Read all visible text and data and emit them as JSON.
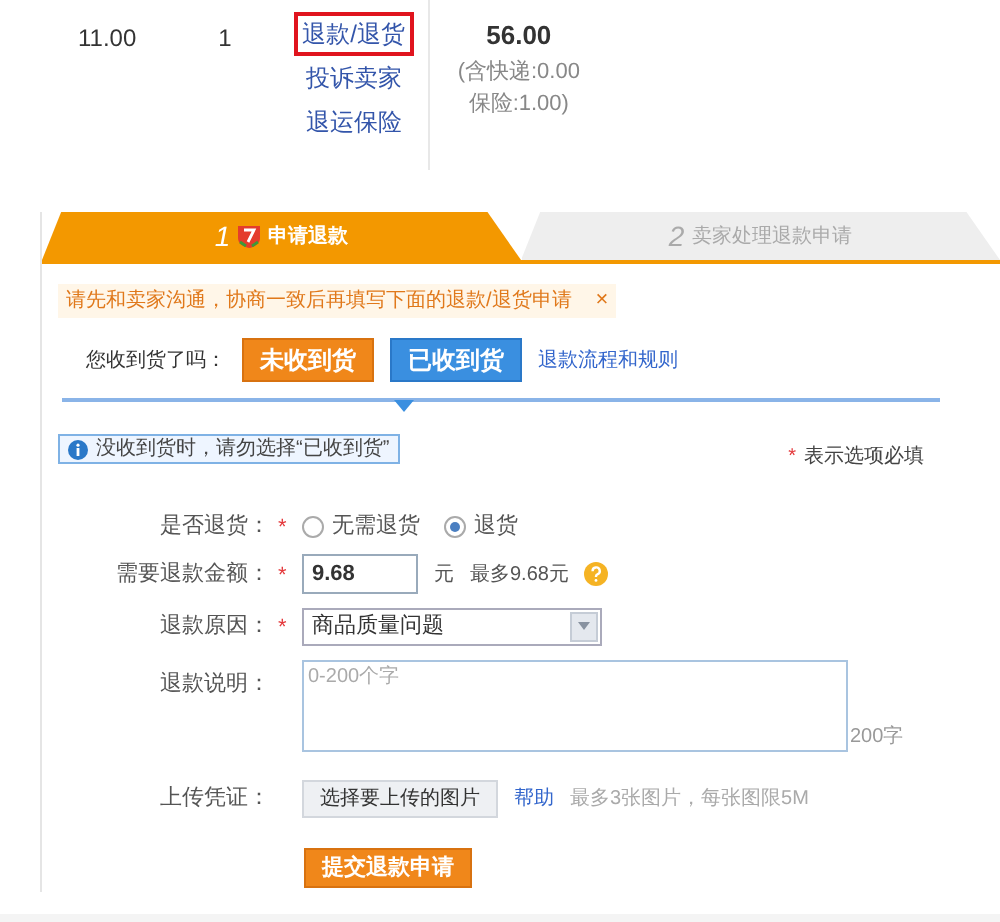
{
  "order_row": {
    "price": "11.00",
    "quantity": "1",
    "actions": [
      {
        "label": "退款/退货",
        "highlighted": true
      },
      {
        "label": "投诉卖家",
        "highlighted": false
      },
      {
        "label": "退运保险",
        "highlighted": false
      }
    ],
    "total": "56.00",
    "shipping_note": "(含快递:0.00",
    "insurance_note": "保险:1.00)"
  },
  "steps": [
    {
      "number": "1",
      "label": "申请退款",
      "selected": true
    },
    {
      "number": "2",
      "label": "卖家处理退款申请",
      "selected": false
    }
  ],
  "notice": {
    "text": "请先和卖家沟通，协商一致后再填写下面的退款/退货申请",
    "close": "×"
  },
  "received_question": {
    "label": "您收到货了吗：",
    "options": [
      {
        "label": "未收到货",
        "selected": false
      },
      {
        "label": "已收到货",
        "selected": true
      }
    ],
    "link": "退款流程和规则"
  },
  "info_tip": "没收到货时，请勿选择“已收到货”",
  "required_note": {
    "mark": "*",
    "text": "表示选项必填"
  },
  "form": {
    "required_mark": "*",
    "fields": [
      {
        "kind": "radio",
        "label": "是否退货：",
        "required": true,
        "options": [
          {
            "label": "无需退货",
            "selected": false
          },
          {
            "label": "退货",
            "selected": true
          }
        ]
      },
      {
        "kind": "amount",
        "label": "需要退款金额：",
        "required": true,
        "value": "9.68",
        "unit": "元",
        "hint": "最多9.68元"
      },
      {
        "kind": "select",
        "label": "退款原因：",
        "required": true,
        "value": "商品质量问题"
      },
      {
        "kind": "textarea",
        "label": "退款说明：",
        "required": false,
        "placeholder": "0-200个字",
        "counter": "200字"
      },
      {
        "kind": "upload",
        "label": "上传凭证：",
        "required": false,
        "button": "选择要上传的图片",
        "help_link": "帮助",
        "hint": "最多3张图片，每张图限5M"
      }
    ]
  },
  "submit": "提交退款申请"
}
